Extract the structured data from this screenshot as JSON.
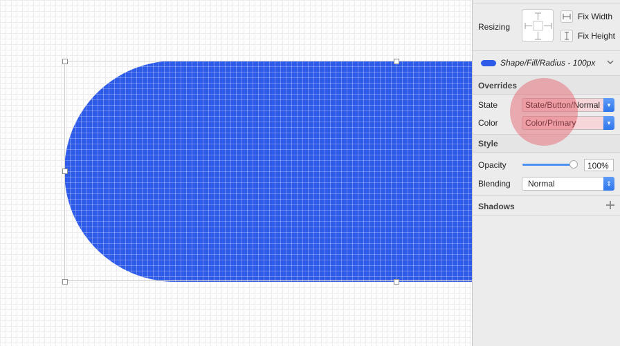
{
  "colors": {
    "shape_fill": "#2f5be9",
    "override_highlight": "#e45867",
    "select_arrow": "#2f76ea",
    "panel_bg": "#ececec"
  },
  "inspector": {
    "resizing": {
      "label": "Resizing",
      "fix_width": "Fix Width",
      "fix_height": "Fix Height"
    },
    "shared_style": {
      "name": "Shape/Fill/Radius - 100px",
      "icon": "chevron-down-icon"
    },
    "overrides": {
      "title": "Overrides",
      "rows": [
        {
          "label": "State",
          "value": "State/Button/Normal"
        },
        {
          "label": "Color",
          "value": "Color/Primary"
        }
      ]
    },
    "style": {
      "title": "Style",
      "opacity": {
        "label": "Opacity",
        "value": "100%",
        "level": 1.0
      },
      "blending": {
        "label": "Blending",
        "value": "Normal"
      }
    },
    "shadows": {
      "title": "Shadows",
      "add_icon": "plus-icon"
    }
  }
}
